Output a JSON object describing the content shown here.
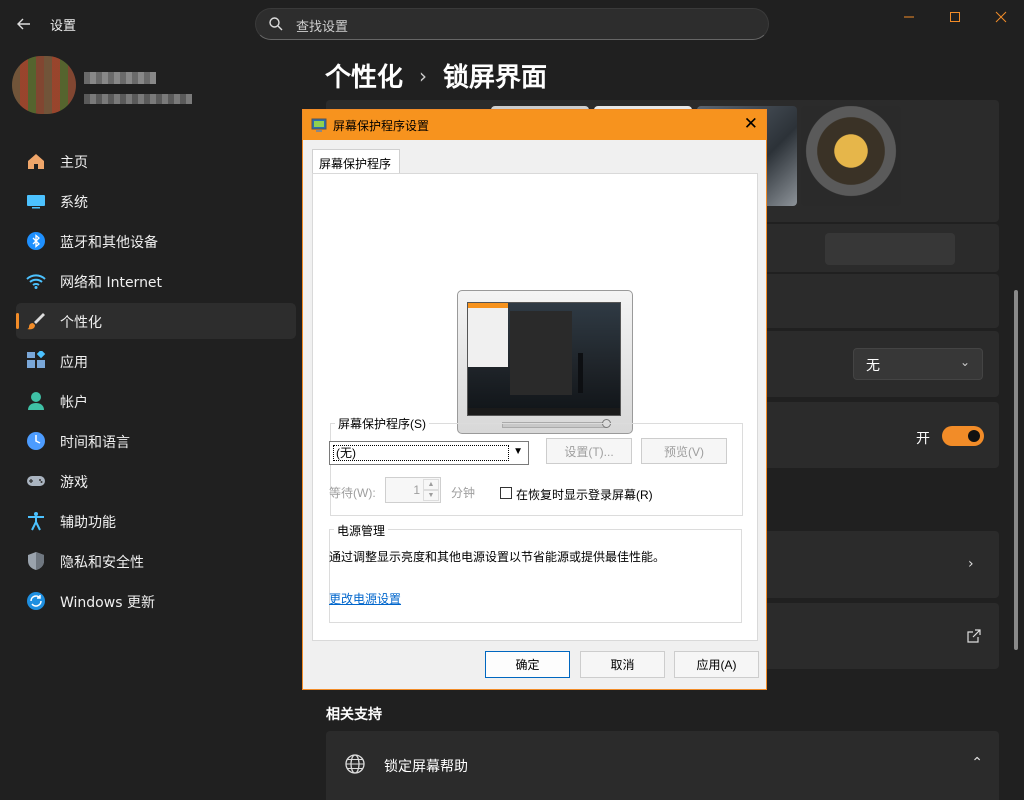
{
  "window": {
    "title": "设置",
    "search_placeholder": "查找设置"
  },
  "sidebar": {
    "items": [
      {
        "label": "主页",
        "icon": "home-icon"
      },
      {
        "label": "系统",
        "icon": "system-icon"
      },
      {
        "label": "蓝牙和其他设备",
        "icon": "bluetooth-icon"
      },
      {
        "label": "网络和 Internet",
        "icon": "wifi-icon"
      },
      {
        "label": "个性化",
        "icon": "brush-icon"
      },
      {
        "label": "应用",
        "icon": "apps-icon"
      },
      {
        "label": "帐户",
        "icon": "account-icon"
      },
      {
        "label": "时间和语言",
        "icon": "clock-icon"
      },
      {
        "label": "游戏",
        "icon": "gamepad-icon"
      },
      {
        "label": "辅助功能",
        "icon": "accessibility-icon"
      },
      {
        "label": "隐私和安全性",
        "icon": "shield-icon"
      },
      {
        "label": "Windows 更新",
        "icon": "update-icon"
      }
    ],
    "active_index": 4
  },
  "main": {
    "breadcrumb_parent": "个性化",
    "breadcrumb_separator": "›",
    "breadcrumb_current": "锁屏界面",
    "status_dropdown_value": "无",
    "toggle_label": "开",
    "related_support_title": "相关支持",
    "help_item_label": "锁定屏幕帮助"
  },
  "dialog": {
    "title": "屏幕保护程序设置",
    "tab_label": "屏幕保护程序",
    "screensaver_group_title": "屏幕保护程序(S)",
    "screensaver_value": "(无)",
    "settings_button": "设置(T)...",
    "preview_button": "预览(V)",
    "wait_label": "等待(W):",
    "wait_value": "1",
    "wait_unit": "分钟",
    "show_logon_label": "在恢复时显示登录屏幕(R)",
    "show_logon_checked": false,
    "power_group_title": "电源管理",
    "power_description": "通过调整显示亮度和其他电源设置以节省能源或提供最佳性能。",
    "power_link": "更改电源设置",
    "ok_button": "确定",
    "cancel_button": "取消",
    "apply_button": "应用(A)"
  },
  "colors": {
    "accent": "#f28c28",
    "background": "#202020",
    "card": "#2b2b2b"
  }
}
